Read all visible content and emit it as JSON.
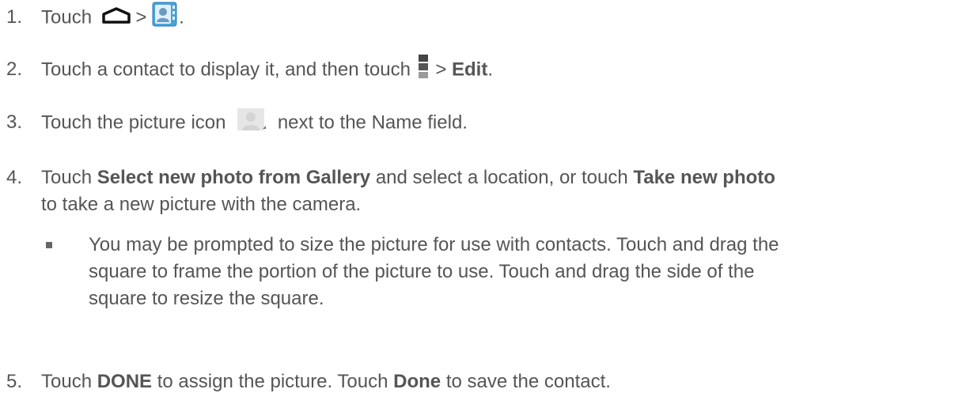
{
  "steps": [
    {
      "num": "1.",
      "before": "Touch",
      "sep": ">",
      "after": "."
    },
    {
      "num": "2.",
      "before": "Touch a contact to display it, and then touch",
      "sep": ">",
      "bold": "Edit",
      "after": "."
    },
    {
      "num": "3.",
      "before": "Touch the picture icon",
      "after": "next to the Name field."
    },
    {
      "num": "4.",
      "before": "Touch",
      "bold1": "Select new photo from Gallery",
      "mid": "and select a location, or touch",
      "bold2": "Take new photo",
      "after": "to take a new picture with the camera."
    },
    {
      "num": "5.",
      "before": "Touch",
      "bold1": "DONE",
      "mid": "to assign the picture. Touch",
      "bold2": "Done",
      "after": "to save the contact."
    }
  ],
  "bullet": {
    "line1": "You may be prompted to size the picture for use with contacts. Touch and drag the",
    "line2": "square to frame the portion of the picture to use. Touch and drag the side of the",
    "line3": "square to resize the square."
  },
  "icons": [
    "home-icon",
    "contacts-app-icon",
    "menu-icon",
    "contact-picture-icon"
  ],
  "colors": {
    "text": "#555555",
    "bold": "#555555"
  }
}
